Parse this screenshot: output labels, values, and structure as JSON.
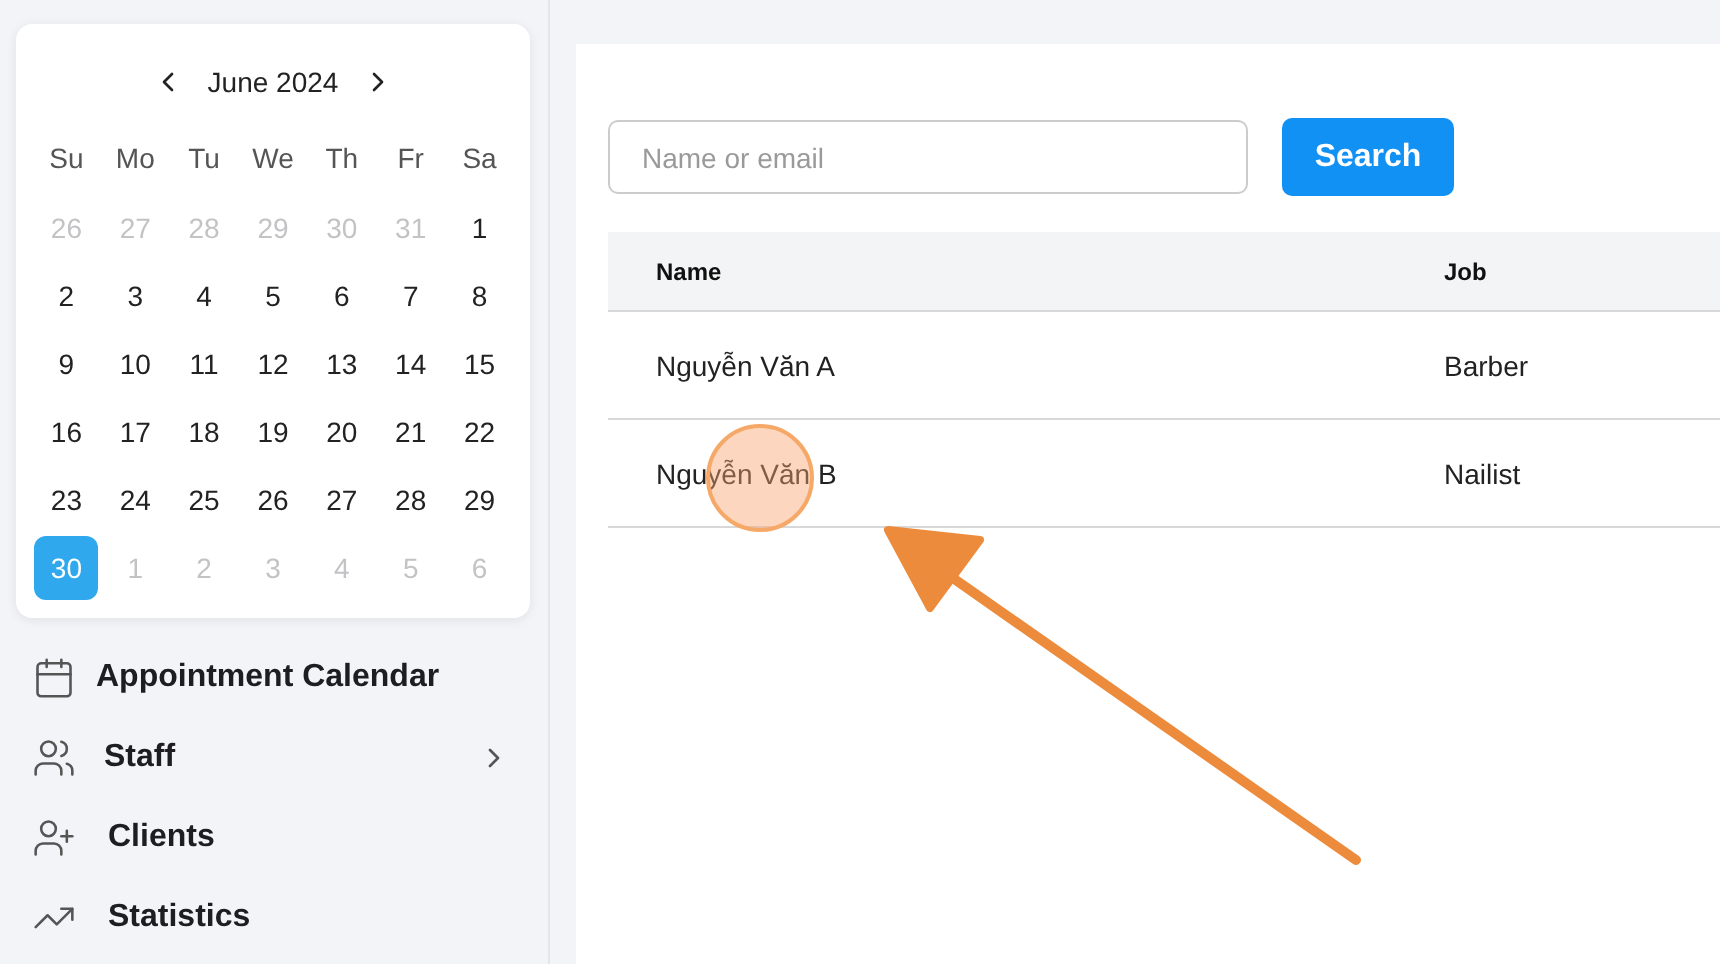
{
  "calendar": {
    "month": "June 2024",
    "weekdays": [
      "Su",
      "Mo",
      "Tu",
      "We",
      "Th",
      "Fr",
      "Sa"
    ],
    "days": [
      {
        "label": "26",
        "muted": true,
        "selected": false
      },
      {
        "label": "27",
        "muted": true,
        "selected": false
      },
      {
        "label": "28",
        "muted": true,
        "selected": false
      },
      {
        "label": "29",
        "muted": true,
        "selected": false
      },
      {
        "label": "30",
        "muted": true,
        "selected": false
      },
      {
        "label": "31",
        "muted": true,
        "selected": false
      },
      {
        "label": "1",
        "muted": false,
        "selected": false
      },
      {
        "label": "2",
        "muted": false,
        "selected": false
      },
      {
        "label": "3",
        "muted": false,
        "selected": false
      },
      {
        "label": "4",
        "muted": false,
        "selected": false
      },
      {
        "label": "5",
        "muted": false,
        "selected": false
      },
      {
        "label": "6",
        "muted": false,
        "selected": false
      },
      {
        "label": "7",
        "muted": false,
        "selected": false
      },
      {
        "label": "8",
        "muted": false,
        "selected": false
      },
      {
        "label": "9",
        "muted": false,
        "selected": false
      },
      {
        "label": "10",
        "muted": false,
        "selected": false
      },
      {
        "label": "11",
        "muted": false,
        "selected": false
      },
      {
        "label": "12",
        "muted": false,
        "selected": false
      },
      {
        "label": "13",
        "muted": false,
        "selected": false
      },
      {
        "label": "14",
        "muted": false,
        "selected": false
      },
      {
        "label": "15",
        "muted": false,
        "selected": false
      },
      {
        "label": "16",
        "muted": false,
        "selected": false
      },
      {
        "label": "17",
        "muted": false,
        "selected": false
      },
      {
        "label": "18",
        "muted": false,
        "selected": false
      },
      {
        "label": "19",
        "muted": false,
        "selected": false
      },
      {
        "label": "20",
        "muted": false,
        "selected": false
      },
      {
        "label": "21",
        "muted": false,
        "selected": false
      },
      {
        "label": "22",
        "muted": false,
        "selected": false
      },
      {
        "label": "23",
        "muted": false,
        "selected": false
      },
      {
        "label": "24",
        "muted": false,
        "selected": false
      },
      {
        "label": "25",
        "muted": false,
        "selected": false
      },
      {
        "label": "26",
        "muted": false,
        "selected": false
      },
      {
        "label": "27",
        "muted": false,
        "selected": false
      },
      {
        "label": "28",
        "muted": false,
        "selected": false
      },
      {
        "label": "29",
        "muted": false,
        "selected": false
      },
      {
        "label": "30",
        "muted": false,
        "selected": true
      },
      {
        "label": "1",
        "muted": true,
        "selected": false
      },
      {
        "label": "2",
        "muted": true,
        "selected": false
      },
      {
        "label": "3",
        "muted": true,
        "selected": false
      },
      {
        "label": "4",
        "muted": true,
        "selected": false
      },
      {
        "label": "5",
        "muted": true,
        "selected": false
      },
      {
        "label": "6",
        "muted": true,
        "selected": false
      }
    ]
  },
  "sidebar": {
    "items": [
      {
        "label": "Appointment Calendar",
        "kind": "calendar",
        "expandable": false
      },
      {
        "label": "Staff",
        "kind": "staff",
        "expandable": true
      },
      {
        "label": "Clients",
        "kind": "clients",
        "expandable": false
      },
      {
        "label": "Statistics",
        "kind": "statistics",
        "expandable": false
      }
    ]
  },
  "search": {
    "placeholder": "Name or email",
    "button": "Search"
  },
  "table": {
    "columns": [
      "Name",
      "Job"
    ],
    "rows": [
      [
        "Nguyễn Văn A",
        "Barber"
      ],
      [
        "Nguyễn Văn B",
        "Nailist"
      ]
    ]
  }
}
